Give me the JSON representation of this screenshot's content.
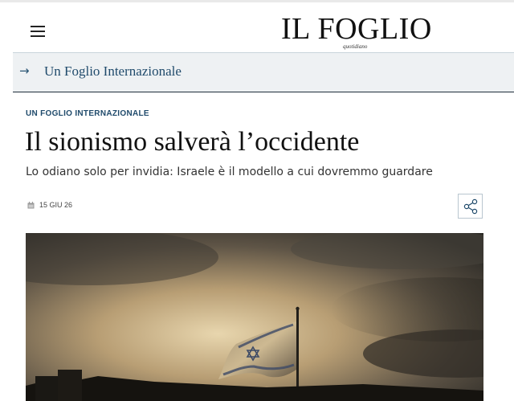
{
  "header": {
    "logo": "IL FOGLIO",
    "logo_sub": "quotidiano",
    "menu_icon": "hamburger-icon"
  },
  "section": {
    "arrow": "→",
    "title": "Un Foglio Internazionale"
  },
  "article": {
    "kicker": "UN FOGLIO INTERNAZIONALE",
    "headline": "Il sionismo salverà l’occidente",
    "subheadline": "Lo odiano solo per invidia: Israele è il modello a cui dovremmo guardare",
    "date": "15 GIU 26",
    "date_icon": "calendar-icon",
    "share_icon": "share-icon"
  },
  "hero_image": {
    "subject": "flag-silhouette",
    "colors": {
      "sky_light": "#d9c39a",
      "sky_dark": "#3a3833",
      "ground": "#15130f"
    }
  },
  "colors": {
    "accent": "#1f4a6b",
    "band_bg": "#eef1f3"
  }
}
